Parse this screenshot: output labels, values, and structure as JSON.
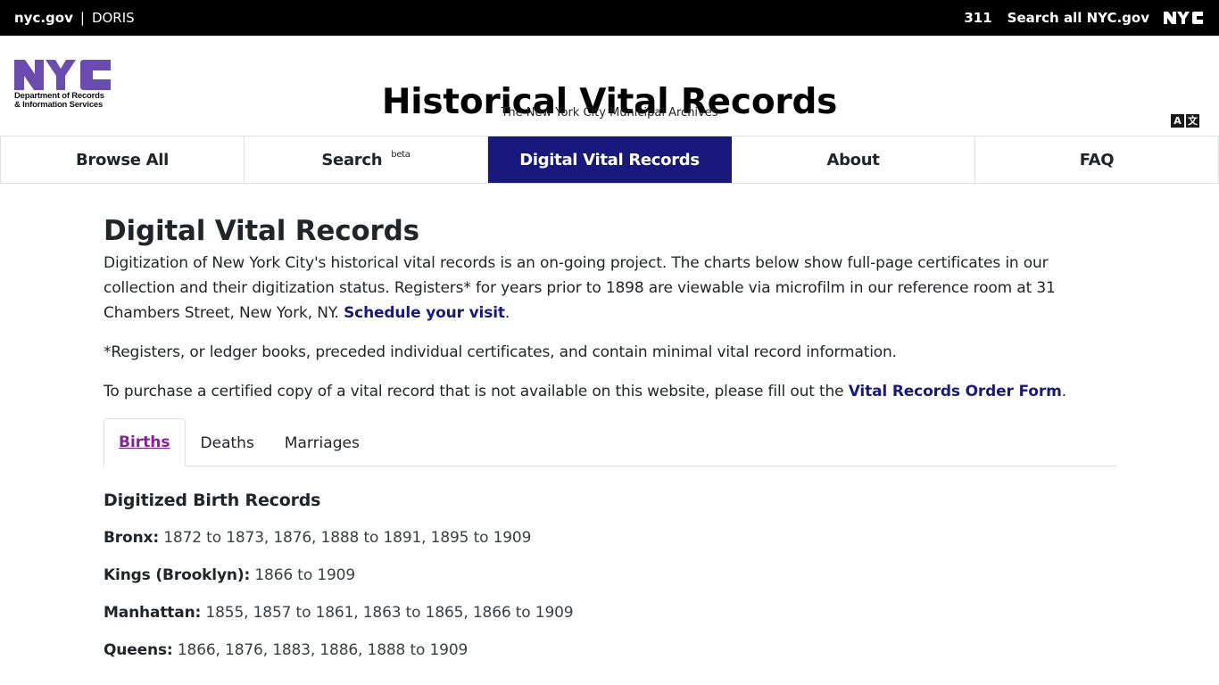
{
  "topbar": {
    "nycgov": "nyc.gov",
    "separator": "|",
    "agency": "DORIS",
    "link_311": "311",
    "search_all": "Search all NYC.gov",
    "nyc_logo": "NYC"
  },
  "header": {
    "logo_text_line1": "Department of Records",
    "logo_text_line2": "& Information Services",
    "logo_color": "#6a4bb0",
    "title": "Historical Vital Records",
    "subtitle": "The New York City Municipal Archives",
    "translate_icon_a": "A",
    "translate_icon_b": "文"
  },
  "nav": {
    "items": [
      {
        "label": "Browse All",
        "badge": ""
      },
      {
        "label": "Search",
        "badge": "beta"
      },
      {
        "label": "Digital Vital Records",
        "badge": "",
        "active": true
      },
      {
        "label": "About",
        "badge": ""
      },
      {
        "label": "FAQ",
        "badge": ""
      }
    ],
    "active_color": "#19197d"
  },
  "main": {
    "title": "Digital Vital Records",
    "intro_text": "Digitization of New York City's historical vital records is an on-going project. The charts below show full-page certificates in our collection and their digitization status. Registers* for years prior to 1898 are viewable via microfilm in our reference room at 31 Chambers Street, New York, NY. ",
    "intro_link": "Schedule your visit",
    "intro_end": ".",
    "note": "*Registers, or ledger books, preceded individual certificates, and contain minimal vital record information.",
    "order_text": "To purchase a certified copy of a vital record that is not available on this website, please fill out the ",
    "order_link": "Vital Records Order Form",
    "order_end": ".",
    "tabs": [
      {
        "label": "Births",
        "active": true
      },
      {
        "label": "Deaths"
      },
      {
        "label": "Marriages"
      }
    ],
    "section_title": "Digitized Birth Records",
    "records": [
      {
        "borough": "Bronx:",
        "years": "1872 to 1873, 1876, 1888 to 1891, 1895 to 1909"
      },
      {
        "borough": "Kings (Brooklyn):",
        "years": "1866 to 1909"
      },
      {
        "borough": "Manhattan:",
        "years": "1855, 1857 to 1861, 1863 to 1865, 1866 to 1909"
      },
      {
        "borough": "Queens:",
        "years": "1866, 1876, 1883, 1886, 1888 to 1909"
      }
    ]
  }
}
